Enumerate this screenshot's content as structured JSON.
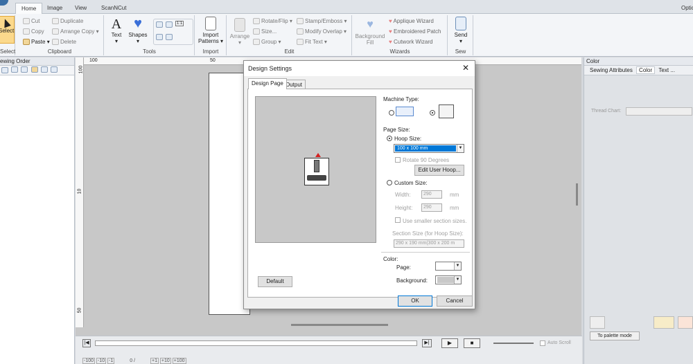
{
  "app": {
    "top_right": "Optic"
  },
  "tabs": [
    "Home",
    "Image",
    "View",
    "ScanNCut"
  ],
  "ribbon": {
    "select": {
      "label": "Select",
      "group": "Select"
    },
    "clipboard": {
      "group": "Clipboard",
      "cut": "Cut",
      "copy": "Copy",
      "paste": "Paste",
      "duplicate": "Duplicate",
      "arrange_copy": "Arrange Copy",
      "delete": "Delete"
    },
    "tools": {
      "group": "Tools",
      "text": "Text",
      "shapes": "Shapes",
      "zoom": "1:1"
    },
    "import": {
      "group": "Import",
      "import_patterns": "Import Patterns"
    },
    "edit": {
      "group": "Edit",
      "arrange": "Arrange",
      "rotate_flip": "Rotate/Flip",
      "size": "Size...",
      "group_btn": "Group",
      "stamp_emboss": "Stamp/Emboss",
      "modify_overlap": "Modify Overlap",
      "fit_text": "Fit Text"
    },
    "wizards": {
      "group": "Wizards",
      "background_fill": "Background Fill",
      "applique": "Applique Wizard",
      "embroidered_patch": "Embroidered Patch",
      "cutwork": "Cutwork Wizard"
    },
    "sew": {
      "group": "Sew",
      "send": "Send"
    }
  },
  "left_panel": {
    "title": "ewing Order"
  },
  "ruler": {
    "h": [
      "100",
      "50"
    ],
    "v": [
      "100",
      "10",
      "50"
    ]
  },
  "right_panel": {
    "title": "Color",
    "tabs": [
      "Sewing Attributes",
      "Color",
      "Text ..."
    ],
    "thread_chart": "Thread Chart:",
    "palette_mode": "To palette mode"
  },
  "bottom": {
    "auto_scroll": "Auto Scroll",
    "steps": [
      "-100",
      "-10",
      "-1",
      "+1",
      "+10",
      "+100"
    ],
    "counter": "0 /"
  },
  "dialog": {
    "title": "Design Settings",
    "tabs": [
      "Design Page",
      "Output"
    ],
    "machine_type": "Machine Type:",
    "page_size": "Page Size:",
    "hoop_size": "Hoop Size:",
    "hoop_value": "100 x 100 mm",
    "rotate": "Rotate 90 Degrees",
    "edit_user_hoop": "Edit User Hoop...",
    "custom_size": "Custom Size:",
    "width": "Width:",
    "height": "Height:",
    "width_value": "290",
    "height_value": "290",
    "unit": "mm",
    "smaller_sections": "Use smaller section sizes.",
    "section_size": "Section Size (for Hoop Size):",
    "section_value": "290 x 190 mm(300 x 200 m",
    "color": "Color:",
    "page": "Page:",
    "background": "Background:",
    "default": "Default",
    "ok": "OK",
    "cancel": "Cancel",
    "colors": {
      "page": "#ffffff",
      "background": "#c8c8c8"
    }
  }
}
